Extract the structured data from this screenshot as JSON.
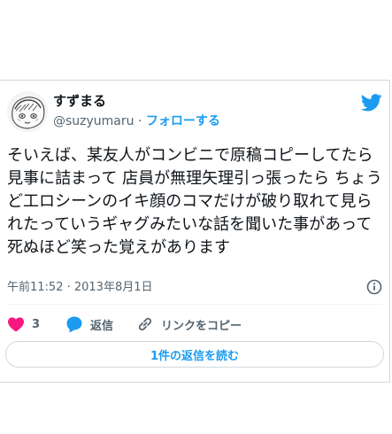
{
  "author": {
    "display_name": "すずまる",
    "handle": "@suzyumaru",
    "separator": "·",
    "follow_label": "フォローする",
    "avatar_icon": "avatar-illustration"
  },
  "platform_icon": "twitter-bird-icon",
  "tweet": {
    "text": "そいえば、某友人がコンビニで原稿コピーしてたら見事に詰まって 店員が無理矢理引っ張ったら ちょうど工ロシーンのイキ顔のコマだけが破り取れて見られたっていうギャグみたいな話を聞いた事があって死ぬほど笑った覚えがあります",
    "timestamp": "午前11:52 · 2013年8月1日"
  },
  "actions": {
    "like_count": "3",
    "reply_label": "返信",
    "copy_link_label": "リンクをコピー"
  },
  "read_replies_label": "1件の返信を読む",
  "colors": {
    "accent": "#1d9bf0",
    "like": "#f91880",
    "text": "#0f1419",
    "muted": "#536471",
    "border": "#cfd9de"
  }
}
